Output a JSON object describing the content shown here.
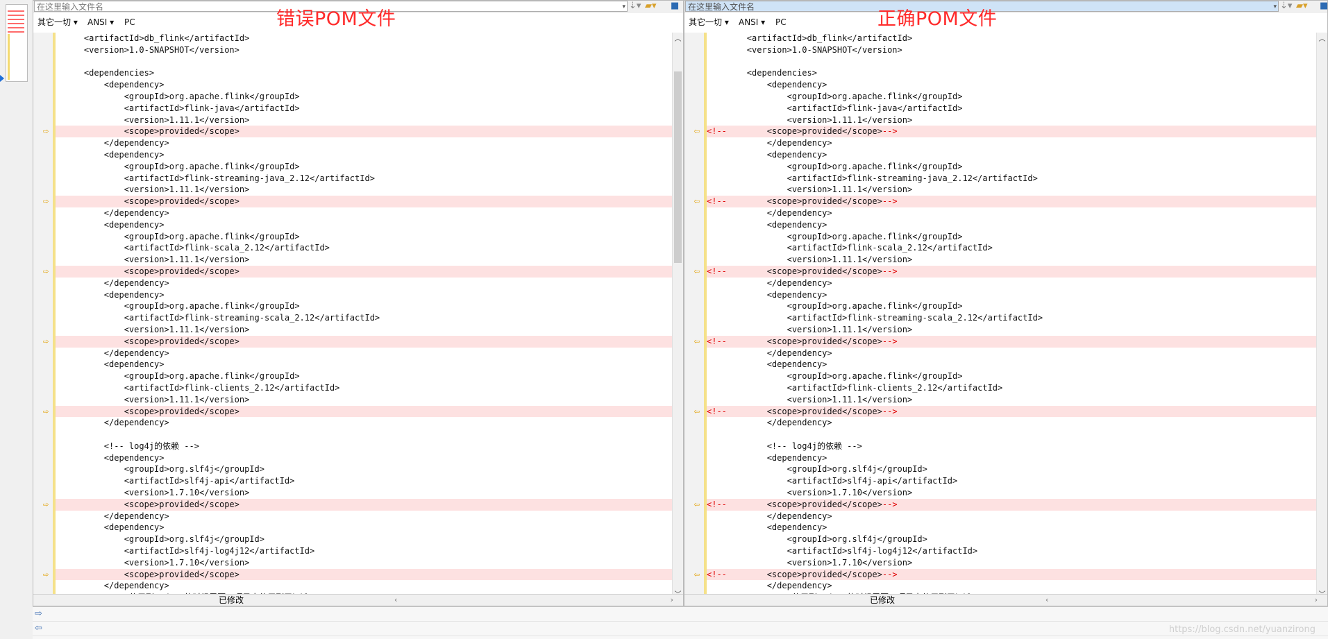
{
  "colors": {
    "diff_bg": "#fde1e1",
    "comment_red": "#e00000",
    "arrow": "#e2a000",
    "note_red": "#ff2b2b"
  },
  "left": {
    "path_placeholder": "在这里输入文件名",
    "note": "错误POM文件",
    "toolbar": {
      "filter": "其它一切",
      "encoding": "ANSI",
      "eol": "PC"
    },
    "status": "已修改",
    "arrow_icon": "arrow-right-icon"
  },
  "right": {
    "path_placeholder": "在这里输入文件名",
    "note": "正确POM文件",
    "toolbar": {
      "filter": "其它一切",
      "encoding": "ANSI",
      "eol": "PC"
    },
    "status": "已修改",
    "arrow_icon": "arrow-left-icon"
  },
  "lines": [
    {
      "t": "    <artifactId>db_flink</artifactId>"
    },
    {
      "t": "    <version>1.0-SNAPSHOT</version>"
    },
    {
      "t": ""
    },
    {
      "t": "    <dependencies>"
    },
    {
      "t": "        <dependency>"
    },
    {
      "t": "            <groupId>org.apache.flink</groupId>"
    },
    {
      "t": "            <artifactId>flink-java</artifactId>"
    },
    {
      "t": "            <version>1.11.1</version>"
    },
    {
      "t": "            <scope>provided</scope>",
      "diff": true
    },
    {
      "t": "        </dependency>"
    },
    {
      "t": "        <dependency>"
    },
    {
      "t": "            <groupId>org.apache.flink</groupId>"
    },
    {
      "t": "            <artifactId>flink-streaming-java_2.12</artifactId>"
    },
    {
      "t": "            <version>1.11.1</version>"
    },
    {
      "t": "            <scope>provided</scope>",
      "diff": true
    },
    {
      "t": "        </dependency>"
    },
    {
      "t": "        <dependency>"
    },
    {
      "t": "            <groupId>org.apache.flink</groupId>"
    },
    {
      "t": "            <artifactId>flink-scala_2.12</artifactId>"
    },
    {
      "t": "            <version>1.11.1</version>"
    },
    {
      "t": "            <scope>provided</scope>",
      "diff": true
    },
    {
      "t": "        </dependency>"
    },
    {
      "t": "        <dependency>"
    },
    {
      "t": "            <groupId>org.apache.flink</groupId>"
    },
    {
      "t": "            <artifactId>flink-streaming-scala_2.12</artifactId>"
    },
    {
      "t": "            <version>1.11.1</version>"
    },
    {
      "t": "            <scope>provided</scope>",
      "diff": true
    },
    {
      "t": "        </dependency>"
    },
    {
      "t": "        <dependency>"
    },
    {
      "t": "            <groupId>org.apache.flink</groupId>"
    },
    {
      "t": "            <artifactId>flink-clients_2.12</artifactId>"
    },
    {
      "t": "            <version>1.11.1</version>"
    },
    {
      "t": "            <scope>provided</scope>",
      "diff": true
    },
    {
      "t": "        </dependency>"
    },
    {
      "t": ""
    },
    {
      "t": "        <!-- log4j的依赖 -->"
    },
    {
      "t": "        <dependency>"
    },
    {
      "t": "            <groupId>org.slf4j</groupId>"
    },
    {
      "t": "            <artifactId>slf4j-api</artifactId>"
    },
    {
      "t": "            <version>1.7.10</version>"
    },
    {
      "t": "            <scope>provided</scope>",
      "diff": true
    },
    {
      "t": "        </dependency>"
    },
    {
      "t": "        <dependency>"
    },
    {
      "t": "            <groupId>org.slf4j</groupId>"
    },
    {
      "t": "            <artifactId>slf4j-log4j12</artifactId>"
    },
    {
      "t": "            <version>1.7.10</version>"
    },
    {
      "t": "            <scope>provided</scope>",
      "diff": true
    },
    {
      "t": "        </dependency>"
    },
    {
      "t": "        <!-- 使用到Hadoop的时候需要，项目中使用到了hdfs -->"
    }
  ],
  "right_comment_open": "<!--",
  "right_comment_close": "-->",
  "watermark": "https://blog.csdn.net/yuanzirong"
}
